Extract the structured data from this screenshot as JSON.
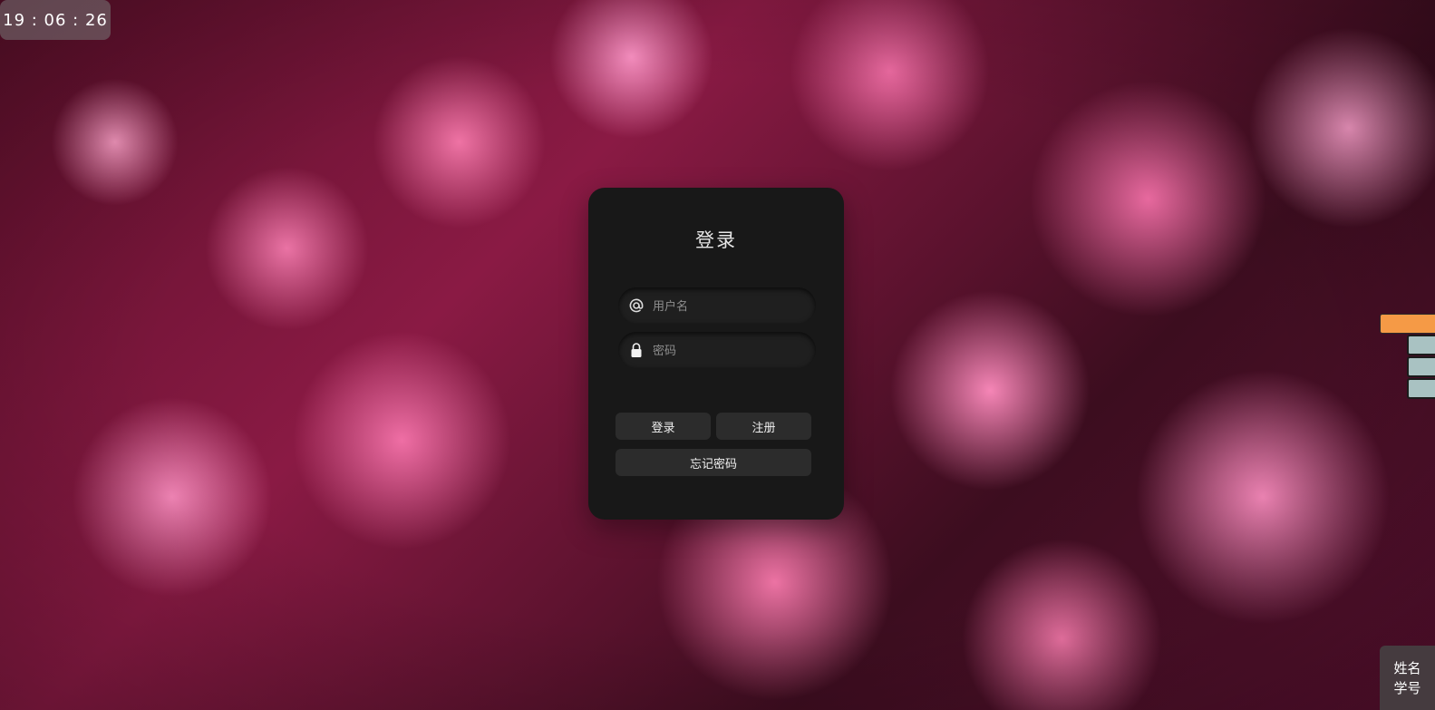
{
  "clock": {
    "time": "19 : 06 : 26"
  },
  "login": {
    "title": "登录",
    "username": {
      "value": "",
      "placeholder": "用户名",
      "icon": "at-icon"
    },
    "password": {
      "value": "",
      "placeholder": "密码",
      "icon": "lock-icon"
    },
    "buttons": {
      "login": "登录",
      "register": "注册",
      "forgot": "忘记密码"
    }
  },
  "side_panel": {
    "name": "姓名",
    "student_id": "学号"
  },
  "colors": {
    "card_bg": "#181818",
    "button_bg": "#2c2c2c",
    "accent_orange": "#f59a46",
    "side_tab": "#a9c2c2"
  }
}
